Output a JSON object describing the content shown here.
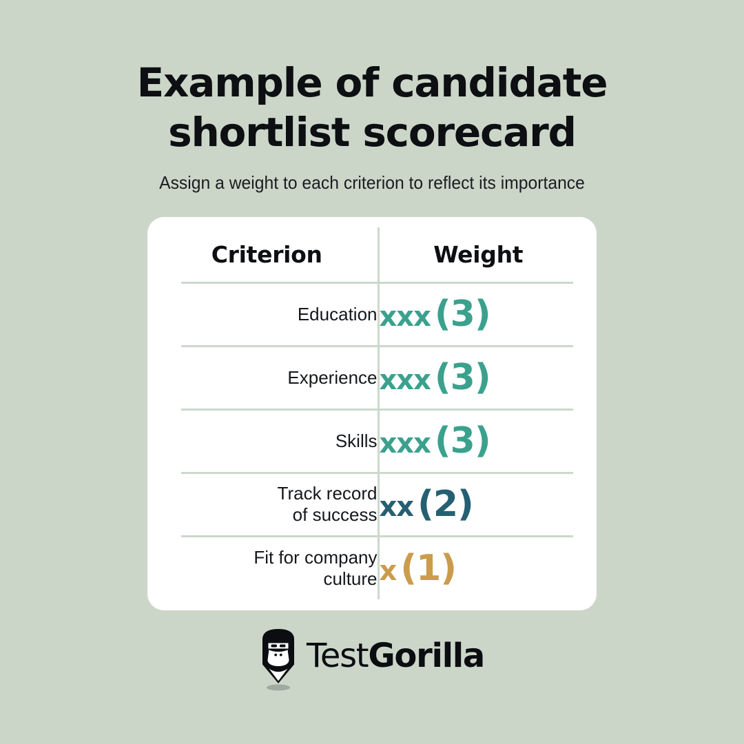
{
  "theme": {
    "background": "#cbd6c9",
    "card_background": "#ffffff",
    "divider": "#ccd8cb",
    "text": "#16181c",
    "accent_teal": "#3ba18d",
    "accent_dark_blue": "#265f72",
    "accent_gold": "#cb9c4d"
  },
  "heading": {
    "title": "Example of candidate shortlist scorecard",
    "subtitle": "Assign a weight to each criterion to reflect its importance"
  },
  "table": {
    "columns": [
      "Criterion",
      "Weight"
    ],
    "rows": [
      {
        "criterion": "Education",
        "marks": "xxx",
        "number": "(3)",
        "weight_value": 3,
        "color": "#3ba18d"
      },
      {
        "criterion": "Experience",
        "marks": "xxx",
        "number": "(3)",
        "weight_value": 3,
        "color": "#3ba18d"
      },
      {
        "criterion": "Skills",
        "marks": "xxx",
        "number": "(3)",
        "weight_value": 3,
        "color": "#3ba18d"
      },
      {
        "criterion": "Track record\nof success",
        "marks": "xx",
        "number": "(2)",
        "weight_value": 2,
        "color": "#265f72"
      },
      {
        "criterion": "Fit for company\nculture",
        "marks": "x",
        "number": "(1)",
        "weight_value": 1,
        "color": "#cb9c4d"
      }
    ]
  },
  "logo": {
    "icon": "gorilla-pin-icon",
    "word_primary": "Test",
    "word_secondary": "Gorilla"
  }
}
